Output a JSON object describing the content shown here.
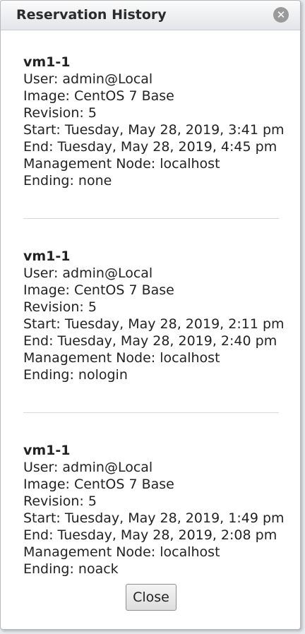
{
  "dialog": {
    "title": "Reservation History",
    "close_icon_glyph": "✕",
    "close_button_label": "Close"
  },
  "reservations": [
    {
      "name": "vm1-1",
      "user": "User: admin@Local",
      "image": "Image: CentOS 7 Base",
      "revision": "Revision: 5",
      "start": "Start: Tuesday, May 28, 2019, 3:41 pm",
      "end": "End: Tuesday, May 28, 2019, 4:45 pm",
      "management_node": "Management Node: localhost",
      "ending": "Ending: none"
    },
    {
      "name": "vm1-1",
      "user": "User: admin@Local",
      "image": "Image: CentOS 7 Base",
      "revision": "Revision: 5",
      "start": "Start: Tuesday, May 28, 2019, 2:11 pm",
      "end": "End: Tuesday, May 28, 2019, 2:40 pm",
      "management_node": "Management Node: localhost",
      "ending": "Ending: nologin"
    },
    {
      "name": "vm1-1",
      "user": "User: admin@Local",
      "image": "Image: CentOS 7 Base",
      "revision": "Revision: 5",
      "start": "Start: Tuesday, May 28, 2019, 1:49 pm",
      "end": "End: Tuesday, May 28, 2019, 2:08 pm",
      "management_node": "Management Node: localhost",
      "ending": "Ending: noack"
    }
  ]
}
